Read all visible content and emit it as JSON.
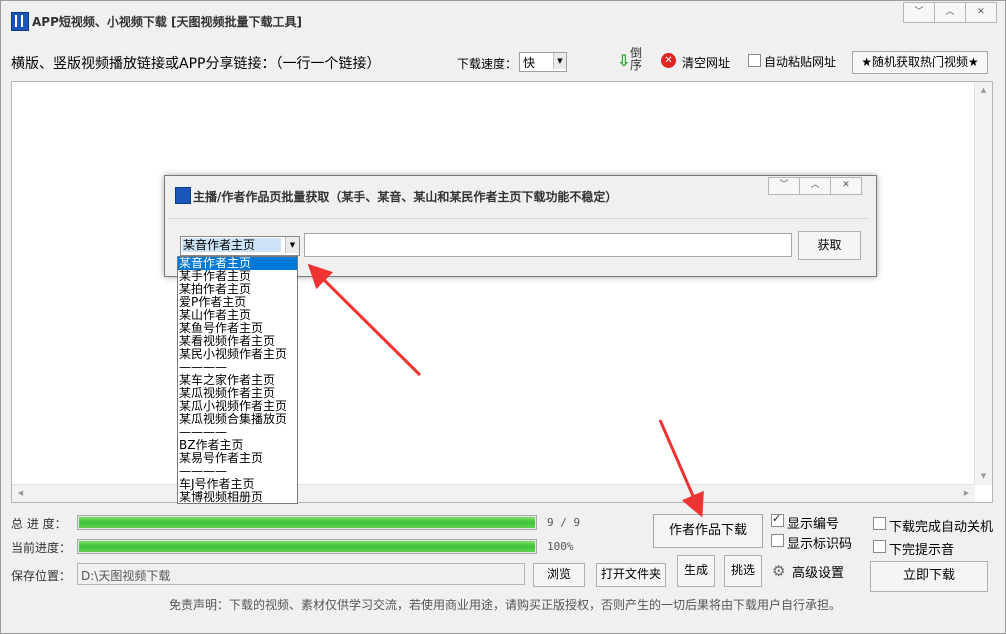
{
  "window": {
    "title": "APP短视频、小视频下载 [天图视频批量下载工具]",
    "controls": [
      "﹀",
      "︿",
      "✕"
    ]
  },
  "toolbar": {
    "link_label": "横版、竖版视频播放链接或APP分享链接：（一行一个链接）",
    "speed_label": "下载速度：",
    "speed_value": "快",
    "reverse_label": "倒序",
    "clear_label": "清空网址",
    "auto_paste_label": "自动粘贴网址",
    "auto_paste_checked": false,
    "hot_videos_label": "★随机获取热门视频★"
  },
  "dialog": {
    "title": "主播/作者作品页批量获取（某手、某音、某山和某民作者主页下载功能不稳定）",
    "controls": [
      "﹀",
      "︿",
      "✕"
    ],
    "selected_platform": "某音作者主页",
    "author_url_value": "",
    "fetch_label": "获取",
    "dropdown_items": [
      "某音作者主页",
      "某手作者主页",
      "某拍作者主页",
      "爱P作者主页",
      "某山作者主页",
      "某鱼号作者主页",
      "某看视频作者主页",
      "某民小视频作者主页",
      "————",
      "某车之家作者主页",
      "某瓜视频作者主页",
      "某瓜小视频作者主页",
      "某瓜视频合集播放页",
      "————",
      "BZ作者主页",
      "某易号作者主页",
      "————",
      "车J号作者主页",
      "某博视频相册页"
    ]
  },
  "progress": {
    "total_label": "总 进 度：",
    "total_value": "9 / 9",
    "total_fraction": 1.0,
    "current_label": "当前进度：",
    "current_value": "100%",
    "current_fraction": 1.0
  },
  "actions": {
    "author_download_label": "作者作品下载",
    "show_number_label": "显示编号",
    "show_number_checked": true,
    "show_id_label": "显示标识码",
    "show_id_checked": false,
    "shutdown_label": "下载完成自动关机",
    "shutdown_checked": false,
    "sound_label": "下完提示音",
    "sound_checked": false,
    "save_label": "保存位置：",
    "save_path": "D:\\天图视频下载",
    "browse_label": "浏览",
    "open_folder_label": "打开文件夹",
    "generate_label": "生成",
    "pick_label": "挑选",
    "advanced_label": "高级设置",
    "download_now_label": "立即下载"
  },
  "disclaimer": "免责声明：下载的视频、素材仅供学习交流，若使用商业用途，请购买正版授权，否则产生的一切后果将由下载用户自行承担。",
  "colors": {
    "selection": "#0078d7",
    "annotation_arrow": "#ee3333",
    "progress_fill": "#3dc13a"
  }
}
